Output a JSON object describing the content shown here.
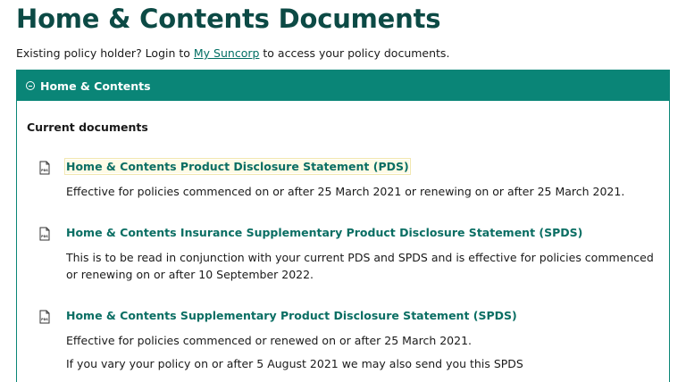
{
  "page": {
    "title": "Home & Contents Documents",
    "intro_before": "Existing policy holder? Login to ",
    "intro_link": "My Suncorp",
    "intro_after": " to access your policy documents."
  },
  "accordion": {
    "title": "Home & Contents",
    "section_heading": "Current documents",
    "documents": [
      {
        "link": "Home & Contents Product Disclosure Statement (PDS)",
        "desc1": "Effective for policies commenced on or after 25 March 2021 or renewing on or after 25 March 2021."
      },
      {
        "link": "Home & Contents Insurance Supplementary Product Disclosure Statement (SPDS)",
        "desc1": "This is to be read in conjunction with your current PDS and SPDS and is effective for policies commenced or renewing on or after 10 September 2022."
      },
      {
        "link": "Home & Contents Supplementary Product Disclosure Statement (SPDS)",
        "desc1": "Effective for policies commenced or renewed on or after 25 March 2021.",
        "desc2": "If you vary your policy on or after 5 August 2021 we may also send you this SPDS"
      }
    ]
  },
  "icons": {
    "pdf": "pdf-icon",
    "accordion_toggle": "minus-circle-icon"
  },
  "colors": {
    "heading": "#0c4a45",
    "accent": "#0a8577",
    "link": "#0a6e63"
  }
}
